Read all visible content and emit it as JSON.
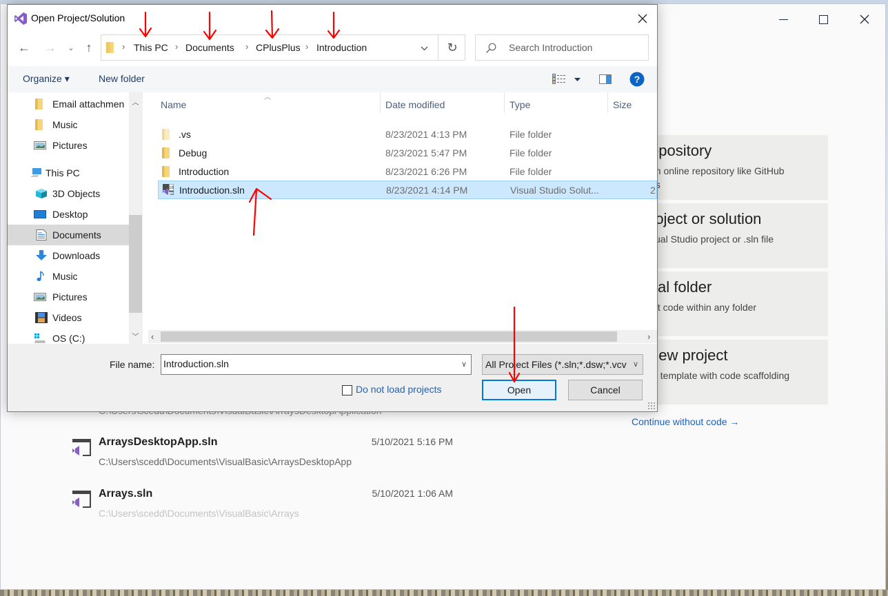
{
  "background_window": {
    "caption_buttons": [
      "minimize",
      "maximize",
      "close"
    ],
    "action_cards": [
      {
        "title": "epository",
        "desc": "an online repository like GitHub",
        "desc2": "ps"
      },
      {
        "title": "roject or solution",
        "desc": "sual Studio project or .sln file"
      },
      {
        "title": "cal folder",
        "desc": "dit code within any folder"
      },
      {
        "title": "new project",
        "desc": "ct template with code scaffolding"
      }
    ],
    "continue_link": "Continue without code →",
    "recent_items": [
      {
        "name": "",
        "date": "",
        "path": "C:\\Users\\scedd\\Documents\\VisualBasic\\ArraysDesktopApplication"
      },
      {
        "name": "ArraysDesktopApp.sln",
        "date": "5/10/2021 5:16 PM",
        "path": "C:\\Users\\scedd\\Documents\\VisualBasic\\ArraysDesktopApp"
      },
      {
        "name": "Arrays.sln",
        "date": "5/10/2021 1:06 AM",
        "path": "C:\\Users\\scedd\\Documents\\VisualBasic\\Arrays"
      }
    ]
  },
  "dialog": {
    "title": "Open Project/Solution",
    "breadcrumb": [
      "This PC",
      "Documents",
      "CPlusPlus",
      "Introduction"
    ],
    "search_placeholder": "Search Introduction",
    "toolbar": {
      "organize": "Organize ▾",
      "new_folder": "New folder"
    },
    "nav_items": [
      {
        "label": "Email attachmen",
        "icon": "folder-icon"
      },
      {
        "label": "Music",
        "icon": "folder-icon"
      },
      {
        "label": "Pictures",
        "icon": "pictures-icon"
      },
      {
        "label": "This PC",
        "icon": "computer-icon"
      },
      {
        "label": "3D Objects",
        "icon": "cube-icon"
      },
      {
        "label": "Desktop",
        "icon": "desktop-icon"
      },
      {
        "label": "Documents",
        "icon": "documents-icon",
        "selected": true
      },
      {
        "label": "Downloads",
        "icon": "download-icon"
      },
      {
        "label": "Music",
        "icon": "music-icon"
      },
      {
        "label": "Pictures",
        "icon": "pictures-icon"
      },
      {
        "label": "Videos",
        "icon": "videos-icon"
      },
      {
        "label": "OS (C:)",
        "icon": "drive-icon"
      }
    ],
    "columns": [
      "Name",
      "Date modified",
      "Type",
      "Size"
    ],
    "files": [
      {
        "name": ".vs",
        "date": "8/23/2021 4:13 PM",
        "type": "File folder",
        "size": "",
        "icon": "folder-icon"
      },
      {
        "name": "Debug",
        "date": "8/23/2021 5:47 PM",
        "type": "File folder",
        "size": "",
        "icon": "folder-icon"
      },
      {
        "name": "Introduction",
        "date": "8/23/2021 6:26 PM",
        "type": "File folder",
        "size": "",
        "icon": "folder-icon"
      },
      {
        "name": "Introduction.sln",
        "date": "8/23/2021 4:14 PM",
        "type": "Visual Studio Solut...",
        "size": "2",
        "icon": "vs-solution-icon",
        "selected": true
      }
    ],
    "file_name_label": "File name:",
    "file_name_value": "Introduction.sln",
    "filter_value": "All Project Files (*.sln;*.dsw;*.vcv",
    "do_not_load_label": "Do not load projects",
    "do_not_load_checked": false,
    "open_label": "Open",
    "cancel_label": "Cancel"
  },
  "colors": {
    "accent_blue": "#0078d7",
    "selection": "#cce8ff",
    "link": "#1c62b9",
    "annotation_red": "#ff0000",
    "vs_purple": "#865fc5"
  }
}
